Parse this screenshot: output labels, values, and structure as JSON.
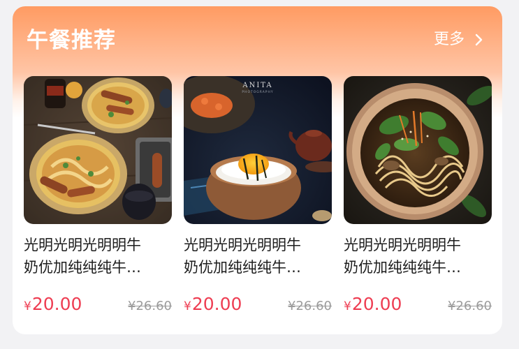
{
  "section": {
    "title": "午餐推荐",
    "more_label": "更多"
  },
  "products": [
    {
      "name_line1": "光明光明光明明牛",
      "name_line2": "奶优加纯纯纯牛…",
      "currency": "¥",
      "price": "20.00",
      "original_price": "¥26.60",
      "image": "bowls-of-noodle-curry-with-sausages-photo"
    },
    {
      "name_line1": "光明光明光明明牛",
      "name_line2": "奶优加纯纯纯牛…",
      "currency": "¥",
      "price": "20.00",
      "original_price": "¥26.60",
      "image": "rice-bowl-with-egg-yolk-photo",
      "watermark_title": "ANITA",
      "watermark_sub": "PHOTOGRAPHY"
    },
    {
      "name_line1": "光明光明光明明牛",
      "name_line2": "奶优加纯纯纯牛…",
      "currency": "¥",
      "price": "20.00",
      "original_price": "¥26.60",
      "image": "noodle-soup-bowl-with-greens-photo"
    }
  ],
  "colors": {
    "header_gradient_top": "#ff9b62",
    "price_red": "#ee3d52",
    "original_price_gray": "#9b9b9b"
  }
}
